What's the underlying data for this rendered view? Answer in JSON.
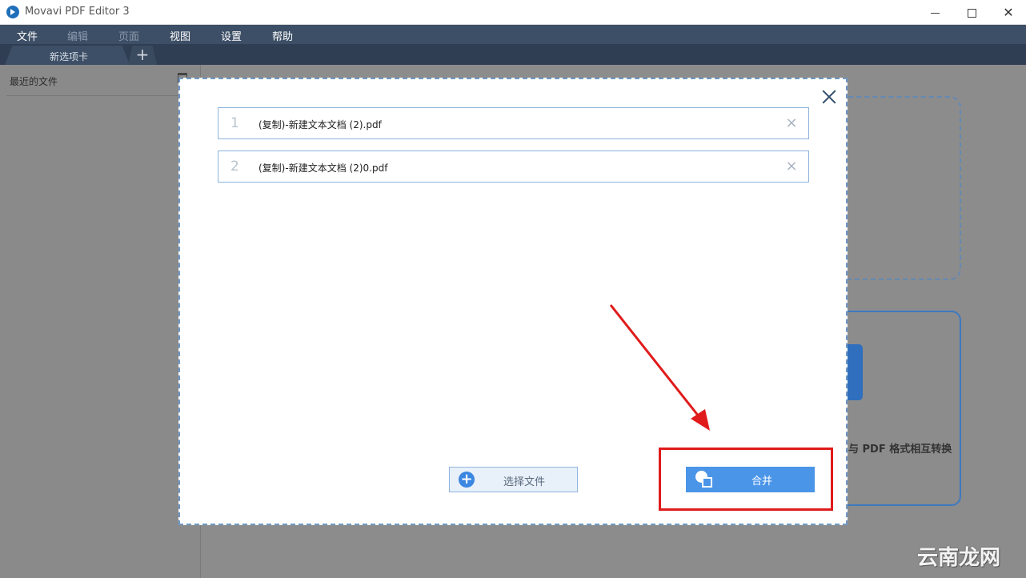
{
  "window": {
    "title": "Movavi PDF Editor 3"
  },
  "menu": {
    "items": [
      "文件",
      "编辑",
      "页面",
      "视图",
      "设置",
      "帮助"
    ]
  },
  "tabs": {
    "current": "新选项卡",
    "add_symbol": "+"
  },
  "sidebar": {
    "title": "最近的文件"
  },
  "background": {
    "card_text": "与 PDF 格式相互转换"
  },
  "dialog": {
    "files": [
      {
        "index": "1",
        "name": "(复制)-新建文本文档 (2).pdf",
        "remove": "×"
      },
      {
        "index": "2",
        "name": "(复制)-新建文本文档 (2)0.pdf",
        "remove": "×"
      }
    ],
    "select_button": {
      "icon": "plus-circle-icon",
      "label": "选择文件"
    },
    "merge_button": {
      "icon": "merge-shapes-icon",
      "label": "合并"
    }
  },
  "watermark": {
    "text": "云南龙网"
  },
  "colors": {
    "menubar": "#3d4f66",
    "accent": "#4a95e8",
    "annotation": "#e01b1b"
  }
}
